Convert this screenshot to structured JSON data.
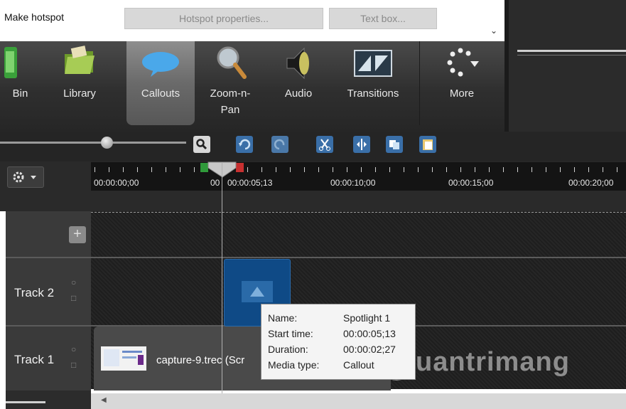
{
  "properties": {
    "title": "Make hotspot",
    "hotspot_button": "Hotspot properties...",
    "textbox_button": "Text box..."
  },
  "toolbar": {
    "items": [
      {
        "label": "Bin",
        "icon": "bin-icon"
      },
      {
        "label": "Library",
        "icon": "folder-icon"
      },
      {
        "label": "Callouts",
        "icon": "speech-bubble-icon"
      },
      {
        "label": "Zoom-n-\nPan",
        "icon": "magnifier-icon"
      },
      {
        "label": "Audio",
        "icon": "speaker-icon"
      },
      {
        "label": "Transitions",
        "icon": "transitions-icon"
      },
      {
        "label": "More",
        "icon": "more-dots-icon"
      }
    ]
  },
  "ruler": {
    "ticks": [
      "00:00:00;00",
      "00:00:05;13",
      "00:00:10;00",
      "00:00:15;00",
      "00:00:20;00"
    ],
    "covered_label": "00"
  },
  "tracks": [
    {
      "name": "Track 2"
    },
    {
      "name": "Track 1"
    }
  ],
  "clip1": {
    "title": "capture-9.trec (Scr"
  },
  "tooltip": {
    "rows": [
      {
        "key": "Name:",
        "value": "Spotlight 1"
      },
      {
        "key": "Start time:",
        "value": "00:00:05;13"
      },
      {
        "key": "Duration:",
        "value": "00:00:02;27"
      },
      {
        "key": "Media type:",
        "value": "Callout"
      }
    ]
  },
  "watermark": {
    "text": "uantrimang"
  },
  "colors": {
    "accent_blue": "#1976d2",
    "clip_blue": "#0f4a86"
  }
}
